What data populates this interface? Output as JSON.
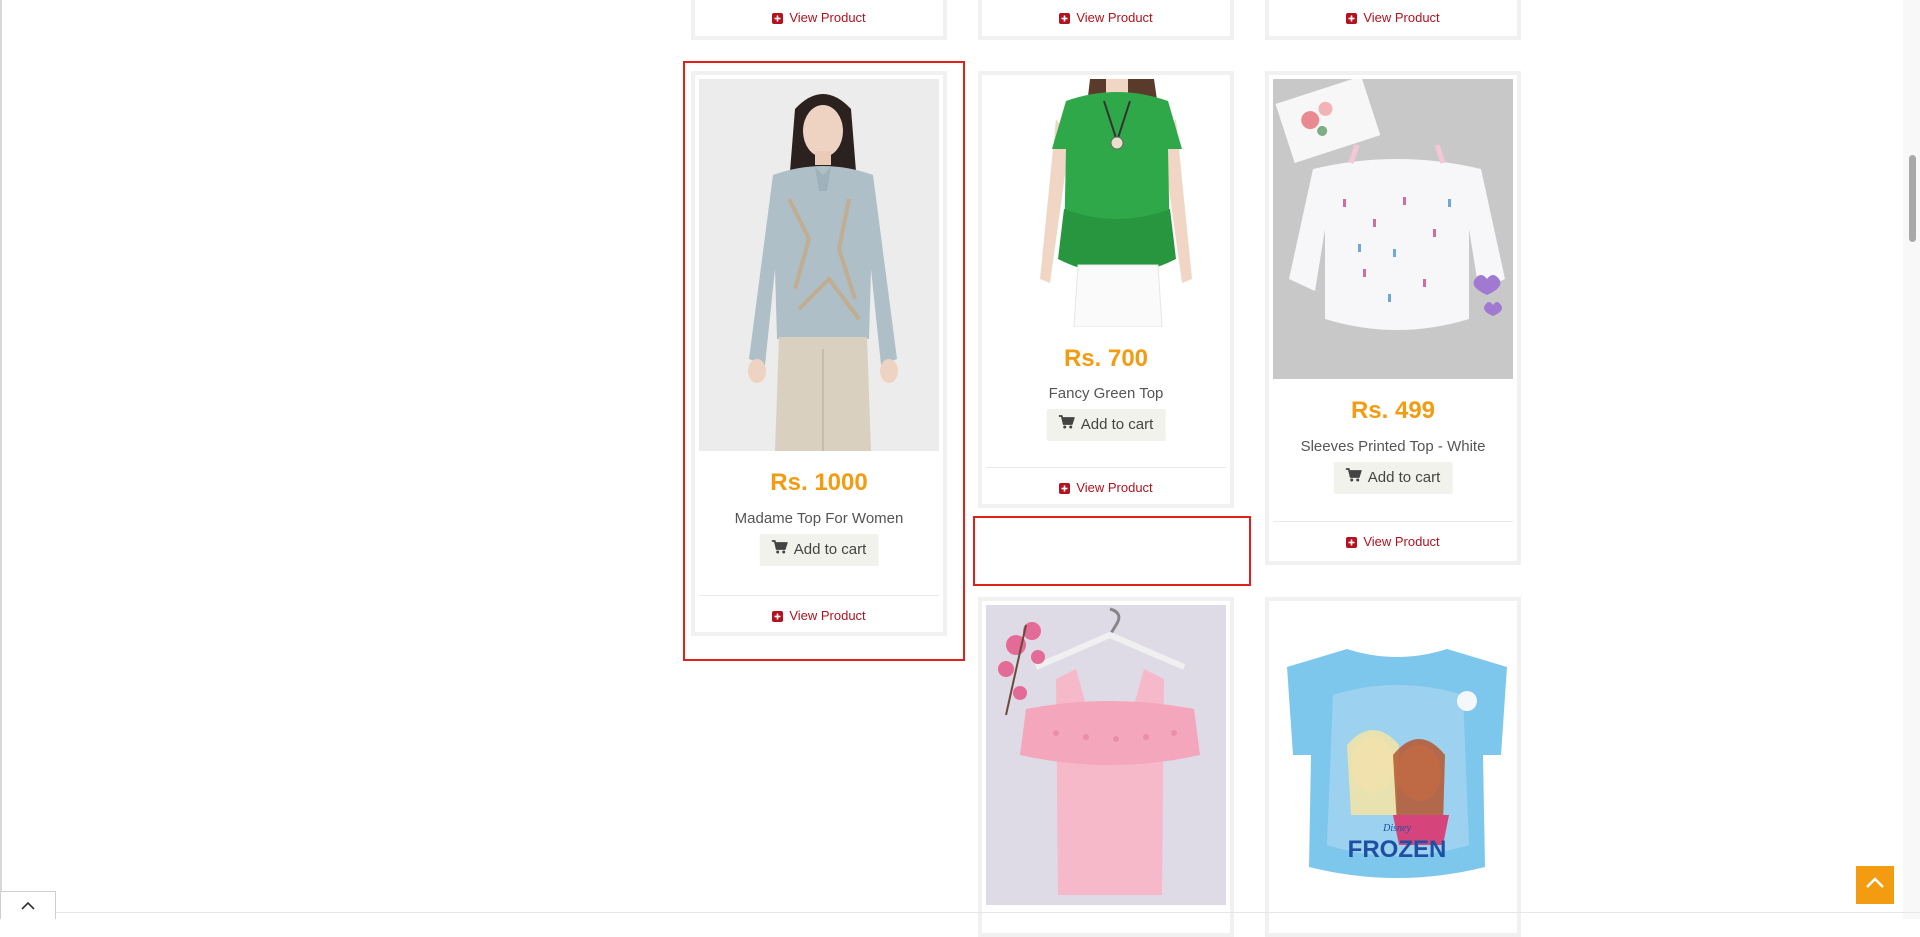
{
  "colors": {
    "price": "#f39c12",
    "link": "#b3121e",
    "highlight": "#e3201a",
    "scroll_top": "#f39c12"
  },
  "icons": {
    "cart": "shopping-cart-icon",
    "view": "plus-square-icon",
    "scroll_top": "chevron-up-icon",
    "panel_toggle": "chevron-up-icon"
  },
  "top_row": [
    {
      "view_label": "View Product"
    },
    {
      "view_label": "View Product"
    },
    {
      "view_label": "View Product"
    }
  ],
  "products": [
    {
      "price": "Rs. 1000",
      "name": "Madame Top For Women",
      "cart_label": "Add to cart",
      "view_label": "View Product"
    },
    {
      "price": "Rs. 700",
      "name": "Fancy Green Top",
      "cart_label": "Add to cart",
      "view_label": "View Product"
    },
    {
      "price": "Rs. 499",
      "name": "Sleeves Printed Top - White",
      "cart_label": "Add to cart",
      "view_label": "View Product"
    }
  ],
  "next_row": {
    "pink_top": {
      "image": "pink-ruffle-top-image"
    },
    "frozen_tee": {
      "image": "frozen-tshirt-image",
      "printed_text": "FROZEN",
      "printed_brand": "Disney"
    }
  }
}
